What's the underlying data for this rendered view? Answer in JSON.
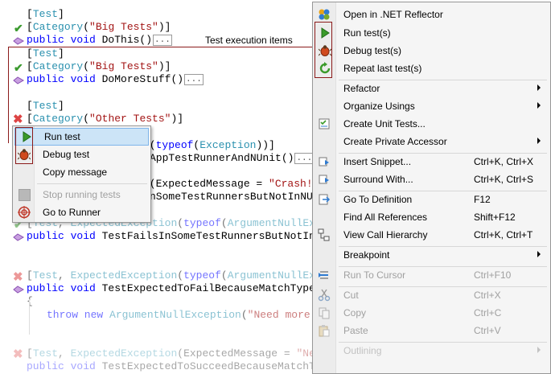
{
  "code": {
    "lines": [
      {
        "parts": [
          [
            "pl",
            "["
          ],
          [
            "ty",
            "Test"
          ],
          [
            "pl",
            "]"
          ]
        ]
      },
      {
        "parts": [
          [
            "pl",
            "["
          ],
          [
            "ty",
            "Category"
          ],
          [
            "pl",
            "("
          ],
          [
            "st",
            "\"Big Tests\""
          ],
          [
            "pl",
            ")]"
          ]
        ]
      },
      {
        "parts": [
          [
            "kw",
            "public void "
          ],
          [
            "pl",
            "DoThis()"
          ]
        ]
      },
      {
        "parts": [
          [
            "pl",
            "["
          ],
          [
            "ty",
            "Test"
          ],
          [
            "pl",
            "]"
          ]
        ]
      },
      {
        "parts": [
          [
            "pl",
            "["
          ],
          [
            "ty",
            "Category"
          ],
          [
            "pl",
            "("
          ],
          [
            "st",
            "\"Big Tests\""
          ],
          [
            "pl",
            ")]"
          ]
        ]
      },
      {
        "parts": [
          [
            "kw",
            "public void "
          ],
          [
            "pl",
            "DoMoreStuff()"
          ]
        ]
      },
      {
        "parts": [
          [
            "pl",
            "["
          ],
          [
            "ty",
            "Test"
          ],
          [
            "pl",
            "]"
          ]
        ]
      },
      {
        "parts": [
          [
            "pl",
            "["
          ],
          [
            "ty",
            "Category"
          ],
          [
            "pl",
            "("
          ],
          [
            "st",
            "\"Other Tests\""
          ],
          [
            "pl",
            ")]"
          ]
        ]
      },
      {
        "parts": [
          [
            "pl",
            "n("
          ],
          [
            "kw",
            "typeof"
          ],
          [
            "pl",
            "("
          ],
          [
            "ty",
            "Exception"
          ],
          [
            "pl",
            "))]"
          ]
        ]
      },
      {
        "parts": [
          [
            "pl",
            "AppTestRunnerAndNUnit()"
          ]
        ]
      },
      {
        "parts": [
          [
            "pl",
            "n(ExpectedMessage = "
          ],
          [
            "st",
            "\"Crash!\""
          ]
        ]
      },
      {
        "parts": [
          [
            "pl",
            "nSomeTestRunnersButNotInNUnit"
          ]
        ]
      },
      {
        "parts": [
          [
            "pl",
            "["
          ],
          [
            "ty",
            "Test"
          ],
          [
            "pl",
            ", "
          ],
          [
            "ty",
            "ExpectedException"
          ],
          [
            "pl",
            "("
          ],
          [
            "kw",
            "typeof"
          ],
          [
            "pl",
            "("
          ],
          [
            "ty",
            "ArgumentNullExcepti"
          ]
        ]
      },
      {
        "parts": [
          [
            "kw",
            "public void "
          ],
          [
            "pl",
            "TestFailsInSomeTestRunnersButNotInNUnit"
          ]
        ]
      },
      {
        "parts": [
          [
            "pl",
            "["
          ],
          [
            "ty",
            "Test"
          ],
          [
            "pl",
            ", "
          ],
          [
            "ty",
            "ExpectedException"
          ],
          [
            "pl",
            "("
          ],
          [
            "kw",
            "typeof"
          ],
          [
            "pl",
            "("
          ],
          [
            "ty",
            "ArgumentNullExcepti"
          ]
        ]
      },
      {
        "parts": [
          [
            "kw",
            "public void "
          ],
          [
            "pl",
            "TestExpectedToFailBecauseMatchTypeIsExa"
          ]
        ]
      },
      {
        "parts": [
          [
            "pl",
            "{"
          ]
        ]
      },
      {
        "parts": [
          [
            "kw",
            "throw new "
          ],
          [
            "ty",
            "ArgumentNullException"
          ],
          [
            "pl",
            "("
          ],
          [
            "st",
            "\"Need more cowb"
          ]
        ]
      },
      {
        "parts": [
          [
            "pl",
            "["
          ],
          [
            "ty",
            "Test"
          ],
          [
            "pl",
            ", "
          ],
          [
            "ty",
            "ExpectedException"
          ],
          [
            "pl",
            "(ExpectedMessage = "
          ],
          [
            "st",
            "\"Need mo"
          ]
        ]
      },
      {
        "parts": [
          [
            "kw",
            "public void "
          ],
          [
            "pl",
            "TestExpectedToSucceedBecauseMatchTypeIs"
          ]
        ]
      }
    ],
    "collapsed_marker": "..."
  },
  "callout_label": "Test execution items",
  "small_menu": {
    "items": [
      {
        "label": "Run test",
        "icon": "play-icon",
        "state": "highlighted"
      },
      {
        "label": "Debug test",
        "icon": "bug-icon",
        "state": "normal"
      },
      {
        "label": "Copy message",
        "icon": "",
        "state": "normal"
      },
      {
        "label": "Stop running tests",
        "icon": "stop-icon",
        "state": "disabled"
      },
      {
        "label": "Go to Runner",
        "icon": "target-icon",
        "state": "normal"
      }
    ]
  },
  "context_menu": {
    "items": [
      {
        "label": "Open in .NET Reflector",
        "shortcut": "",
        "icon": "reflector-icon",
        "submenu": false,
        "disabled": false
      },
      {
        "label": "Run test(s)",
        "shortcut": "",
        "icon": "play-icon",
        "submenu": false,
        "disabled": false
      },
      {
        "label": "Debug test(s)",
        "shortcut": "",
        "icon": "bug-icon",
        "submenu": false,
        "disabled": false
      },
      {
        "label": "Repeat last test(s)",
        "shortcut": "",
        "icon": "repeat-icon",
        "submenu": false,
        "disabled": false
      },
      {
        "label": "Refactor",
        "shortcut": "",
        "icon": "",
        "submenu": true,
        "disabled": false
      },
      {
        "label": "Organize Usings",
        "shortcut": "",
        "icon": "",
        "submenu": true,
        "disabled": false
      },
      {
        "label": "Create Unit Tests...",
        "shortcut": "",
        "icon": "unit-tests-icon",
        "submenu": false,
        "disabled": false
      },
      {
        "label": "Create Private Accessor",
        "shortcut": "",
        "icon": "",
        "submenu": true,
        "disabled": false
      },
      {
        "label": "Insert Snippet...",
        "shortcut": "Ctrl+K, Ctrl+X",
        "icon": "snippet-icon",
        "submenu": false,
        "disabled": false
      },
      {
        "label": "Surround With...",
        "shortcut": "Ctrl+K, Ctrl+S",
        "icon": "surround-icon",
        "submenu": false,
        "disabled": false
      },
      {
        "label": "Go To Definition",
        "shortcut": "F12",
        "icon": "definition-icon",
        "submenu": false,
        "disabled": false
      },
      {
        "label": "Find All References",
        "shortcut": "Shift+F12",
        "icon": "",
        "submenu": false,
        "disabled": false
      },
      {
        "label": "View Call Hierarchy",
        "shortcut": "Ctrl+K, Ctrl+T",
        "icon": "hierarchy-icon",
        "submenu": false,
        "disabled": false
      },
      {
        "label": "Breakpoint",
        "shortcut": "",
        "icon": "",
        "submenu": true,
        "disabled": false
      },
      {
        "label": "Run To Cursor",
        "shortcut": "Ctrl+F10",
        "icon": "run-cursor-icon",
        "submenu": false,
        "disabled": false
      },
      {
        "label": "Cut",
        "shortcut": "Ctrl+X",
        "icon": "scissors-icon",
        "submenu": false,
        "disabled": true
      },
      {
        "label": "Copy",
        "shortcut": "Ctrl+C",
        "icon": "copy-icon",
        "submenu": false,
        "disabled": true
      },
      {
        "label": "Paste",
        "shortcut": "Ctrl+V",
        "icon": "paste-icon",
        "submenu": false,
        "disabled": true
      },
      {
        "label": "Outlining",
        "shortcut": "",
        "icon": "",
        "submenu": true,
        "disabled": true
      }
    ]
  }
}
